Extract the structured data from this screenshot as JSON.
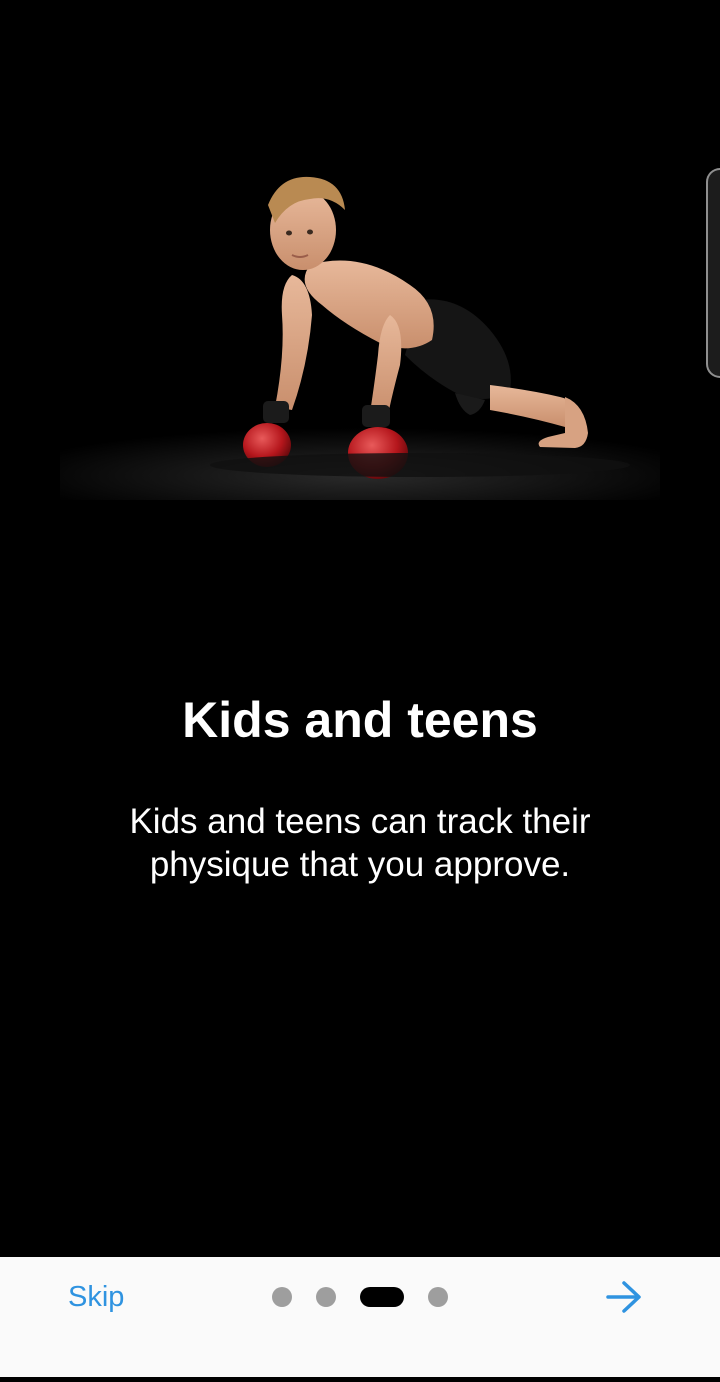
{
  "onboarding": {
    "title": "Kids and teens",
    "description": "Kids and teens can track their physique that you approve.",
    "hero_image": "boy-in-boxing-gloves-doing-push-up"
  },
  "bottom_bar": {
    "skip_label": "Skip",
    "next_icon": "arrow-right-icon",
    "page_count": 4,
    "active_page": 3,
    "accent_color": "#2f93e0"
  },
  "colors": {
    "background": "#000000",
    "bar_background": "#fafafa",
    "dot_inactive": "#9e9e9e",
    "dot_active": "#000000"
  }
}
